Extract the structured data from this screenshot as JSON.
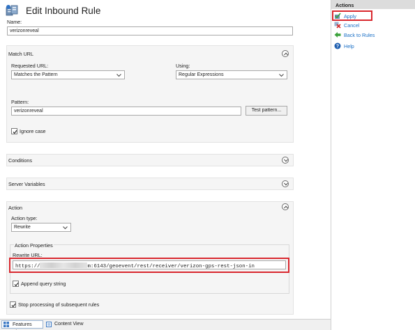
{
  "page": {
    "title": "Edit Inbound Rule"
  },
  "name_field": {
    "label": "Name:",
    "value": "verizonreveal"
  },
  "match_url": {
    "title": "Match URL",
    "requested_url_label": "Requested URL:",
    "requested_url_value": "Matches the Pattern",
    "using_label": "Using:",
    "using_value": "Regular Expressions",
    "pattern_label": "Pattern:",
    "pattern_value": "verizonreveal",
    "test_button": "Test pattern...",
    "ignore_case_label": "Ignore case",
    "ignore_case_checked": true
  },
  "conditions": {
    "title": "Conditions"
  },
  "server_variables": {
    "title": "Server Variables"
  },
  "action": {
    "title": "Action",
    "type_label": "Action type:",
    "type_value": "Rewrite",
    "properties_title": "Action Properties",
    "rewrite_url_label": "Rewrite URL:",
    "rewrite_url_prefix": "https://",
    "rewrite_url_suffix": "m:6143/geoevent/rest/receiver/verizon-gps-rest-json-in",
    "append_query_label": "Append query string",
    "append_query_checked": true,
    "stop_processing_label": "Stop processing of subsequent rules",
    "stop_processing_checked": true
  },
  "actions_pane": {
    "header": "Actions",
    "items": [
      {
        "label": "Apply",
        "icon": "apply-icon"
      },
      {
        "label": "Cancel",
        "icon": "cancel-icon"
      },
      {
        "label": "Back to Rules",
        "icon": "back-arrow-icon"
      },
      {
        "label": "Help",
        "icon": "help-icon"
      }
    ]
  },
  "bottom_tabs": [
    {
      "label": "Features View",
      "icon": "features-view-icon"
    },
    {
      "label": "Content View",
      "icon": "content-view-icon"
    }
  ],
  "colors": {
    "highlight": "#d9272e",
    "link": "#1a6fc6",
    "section_bg": "#f5f5f5"
  }
}
